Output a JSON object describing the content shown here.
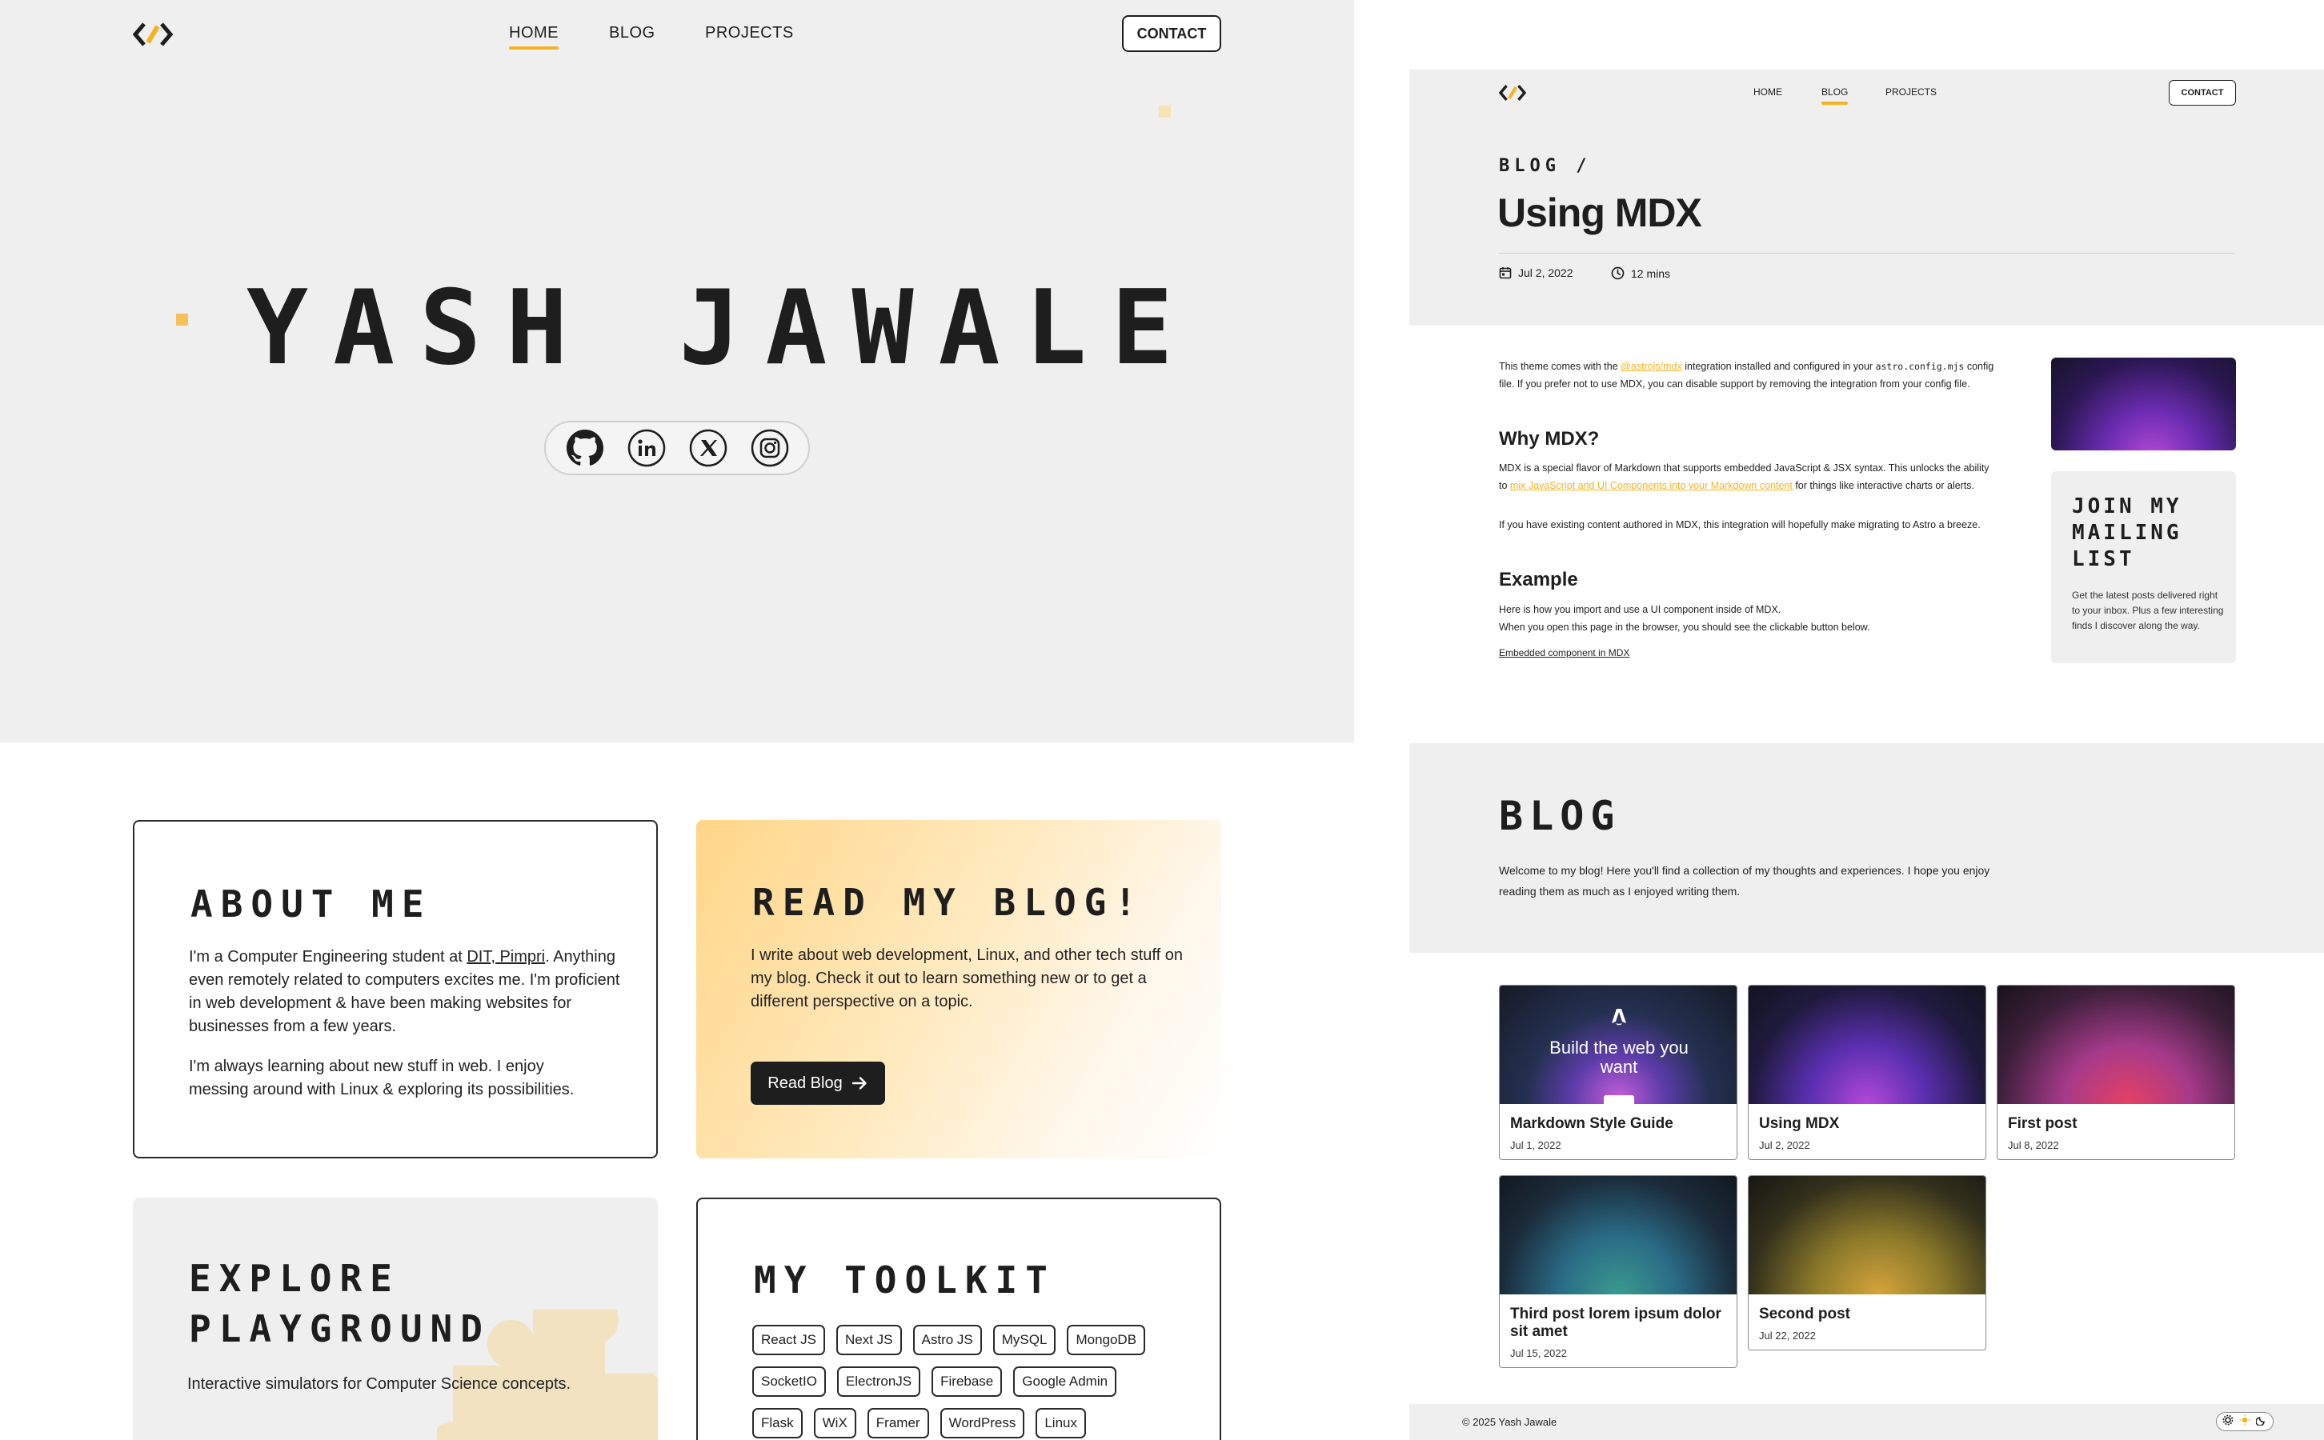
{
  "left": {
    "nav": {
      "logo": "code-bracket-logo",
      "items": [
        {
          "label": "HOME",
          "active": true
        },
        {
          "label": "BLOG",
          "active": false
        },
        {
          "label": "PROJECTS",
          "active": false
        }
      ],
      "contact": "CONTACT"
    },
    "hero": {
      "name": "YASH JAWALE",
      "socials": [
        "github-icon",
        "linkedin-icon",
        "x-icon",
        "instagram-icon"
      ]
    },
    "about": {
      "title": "ABOUT ME",
      "p1_prefix": "I'm a Computer Engineering student at ",
      "p1_link": "DIT, Pimpri",
      "p1_suffix": ". Anything even remotely related to computers excites me. I'm proficient in web development & have been making websites for businesses from a few years.",
      "p2": "I'm always learning about new stuff in web. I enjoy messing around with Linux & exploring its possibilities."
    },
    "blog_card": {
      "title": "READ MY BLOG!",
      "text": "I write about web development, Linux, and other tech stuff on my blog. Check it out to learn something new or to get a different perspective on a topic.",
      "button": "Read Blog"
    },
    "playground": {
      "title_line1": "EXPLORE",
      "title_line2": "PLAYGROUND",
      "text": "Interactive simulators for Computer Science concepts."
    },
    "toolkit": {
      "title": "MY TOOLKIT",
      "row1": [
        "React JS",
        "Next JS",
        "Astro JS",
        "MySQL",
        "MongoDB"
      ],
      "row2": [
        "SocketIO",
        "ElectronJS",
        "Firebase",
        "Google Admin"
      ],
      "row3": [
        "Flask",
        "WiX",
        "Framer",
        "WordPress",
        "Linux"
      ]
    }
  },
  "right": {
    "nav": {
      "items": [
        {
          "label": "HOME",
          "active": false
        },
        {
          "label": "BLOG",
          "active": true
        },
        {
          "label": "PROJECTS",
          "active": false
        }
      ],
      "contact": "CONTACT"
    },
    "post": {
      "breadcrumb": "BLOG /",
      "title": "Using MDX",
      "date": "Jul 2, 2022",
      "read_time": "12 mins",
      "intro_a": "This theme comes with the ",
      "intro_link": "@astrojs/mdx",
      "intro_b": " integration installed and configured in your ",
      "intro_code": "astro.config.mjs",
      "intro_c": " config file. If you prefer not to use MDX, you can disable support by removing the integration from your config file.",
      "h_why": "Why MDX?",
      "why_a": "MDX is a special flavor of Markdown that supports embedded JavaScript & JSX syntax. This unlocks the ability to ",
      "why_link": "mix JavaScript and UI Components into your Markdown content",
      "why_b": " for things like interactive charts or alerts.",
      "why_2": "If you have existing content authored in MDX, this integration will hopefully make migrating to Astro a breeze.",
      "h_example": "Example",
      "ex_1": "Here is how you import and use a UI component inside of MDX.",
      "ex_2": "When you open this page in the browser, you should see the clickable button below.",
      "ex_link": "Embedded component in MDX"
    },
    "mailing": {
      "title_line1": "JOIN MY",
      "title_line2": "MAILING",
      "title_line3": "LIST",
      "text": "Get the latest posts delivered right to your inbox. Plus a few interesting finds I discover along the way."
    },
    "blog": {
      "title": "BLOG",
      "intro": "Welcome to my blog! Here you'll find a collection of my thoughts and experiences. I hope you enjoy reading them as much as I enjoyed writing them.",
      "posts": [
        {
          "title": "Markdown Style Guide",
          "date": "Jul 1, 2022",
          "thumb_text": "Build the web you want"
        },
        {
          "title": "Using MDX",
          "date": "Jul 2, 2022"
        },
        {
          "title": "First post",
          "date": "Jul 8, 2022"
        },
        {
          "title": "Third post lorem ipsum dolor sit amet",
          "date": "Jul 15, 2022"
        },
        {
          "title": "Second post",
          "date": "Jul 22, 2022"
        }
      ]
    },
    "footer": {
      "copyright": "© 2025 Yash Jawale",
      "theme_icons": [
        "gear-icon",
        "sun-icon",
        "moon-icon"
      ]
    }
  },
  "colors": {
    "accent": "#f5b323",
    "surface": "#efefef",
    "ink": "#1e1e1e"
  }
}
